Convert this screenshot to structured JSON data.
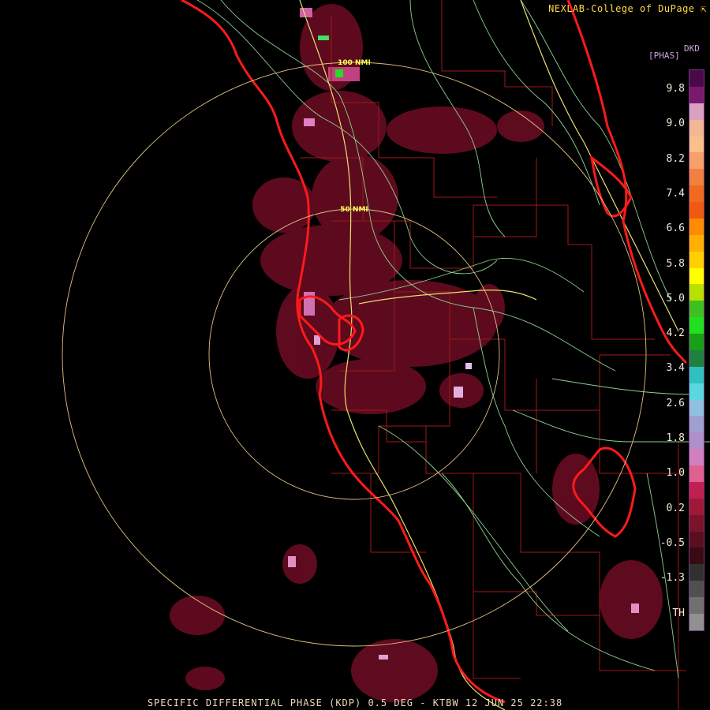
{
  "credit": "NEXLAB-College of DuPage",
  "credit_icon": "cursor-arrow-icon",
  "legend": {
    "product": "DKD",
    "units": "[PHAS]",
    "ticks": [
      "9.8",
      "9.0",
      "8.2",
      "7.4",
      "6.6",
      "5.8",
      "5.0",
      "4.2",
      "3.4",
      "2.6",
      "1.8",
      "1.0",
      "0.2",
      "-0.5",
      "-1.3",
      "TH"
    ],
    "colors": [
      "#4a0a4a",
      "#7a1a6e",
      "#d9a0c2",
      "#f2b894",
      "#f9c08a",
      "#f7a06a",
      "#f28040",
      "#f06a20",
      "#ee5a10",
      "#ff8c00",
      "#ffb000",
      "#ffd000",
      "#ffff00",
      "#b8e000",
      "#40c020",
      "#20e020",
      "#18a018",
      "#208040",
      "#30c0c0",
      "#5ad8e0",
      "#90c0e0",
      "#a0a0d0",
      "#b090c8",
      "#d080c0",
      "#e06090",
      "#c02050",
      "#a01838",
      "#7a1428",
      "#5a0e1e",
      "#3a0a14",
      "#303030",
      "#505050",
      "#707070",
      "#909090"
    ],
    "accent": "#6a3e7a"
  },
  "rings": {
    "inner_label": "50 NMI",
    "outer_label": "100 NMI",
    "color": "#e0c080"
  },
  "footer": "SPECIFIC DIFFERENTIAL PHASE (KDP) 0.5 DEG - KTBW 12 JUN 25 22:38",
  "colors": {
    "coast": "#ff1a1a",
    "counties": "#a01818",
    "roads": "#9ad29a",
    "highways": "#e8e070",
    "echo": "#7a0e2a"
  }
}
